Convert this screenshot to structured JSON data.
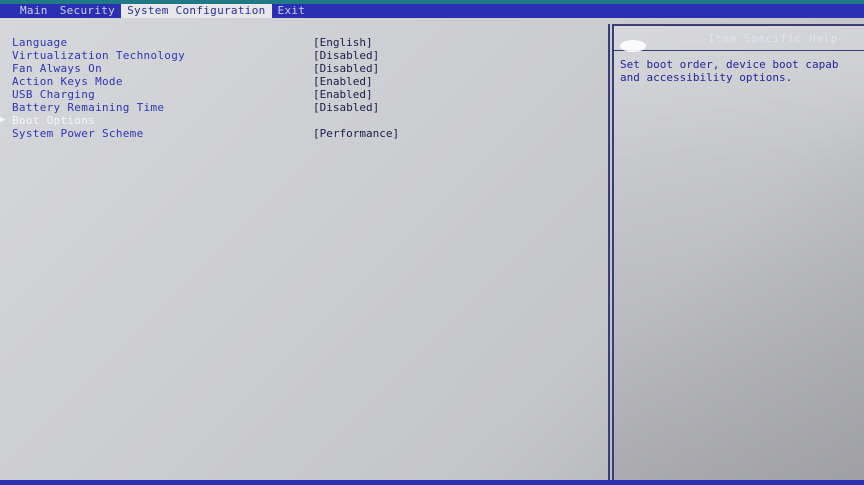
{
  "menubar": {
    "items": [
      {
        "label": "Main"
      },
      {
        "label": "Security"
      },
      {
        "label": "System Configuration"
      },
      {
        "label": "Exit"
      }
    ],
    "active_index": 2
  },
  "settings": [
    {
      "label": "Language",
      "value": "[English]"
    },
    {
      "label": "Virtualization Technology",
      "value": "[Disabled]"
    },
    {
      "label": "Fan Always On",
      "value": "[Disabled]"
    },
    {
      "label": "Action Keys Mode",
      "value": "[Enabled]"
    },
    {
      "label": "USB Charging",
      "value": "[Enabled]"
    },
    {
      "label": "Battery Remaining Time",
      "value": "[Disabled]"
    },
    {
      "label": "Boot Options",
      "value": "",
      "selected": true,
      "submenu": true
    },
    {
      "label": "System Power Scheme",
      "value": "[Performance]"
    }
  ],
  "help": {
    "title": "Item Specific Help",
    "text_line1": "Set boot order, device boot capab",
    "text_line2": "and accessibility options."
  },
  "colors": {
    "menubar_bg": "#2a2fb4",
    "screen_bg": "#c9cacc",
    "label_blue": "#2f35b8",
    "selected_white": "#f4f5ff"
  },
  "icons": {
    "submenu_marker": "triangle-right-icon"
  }
}
